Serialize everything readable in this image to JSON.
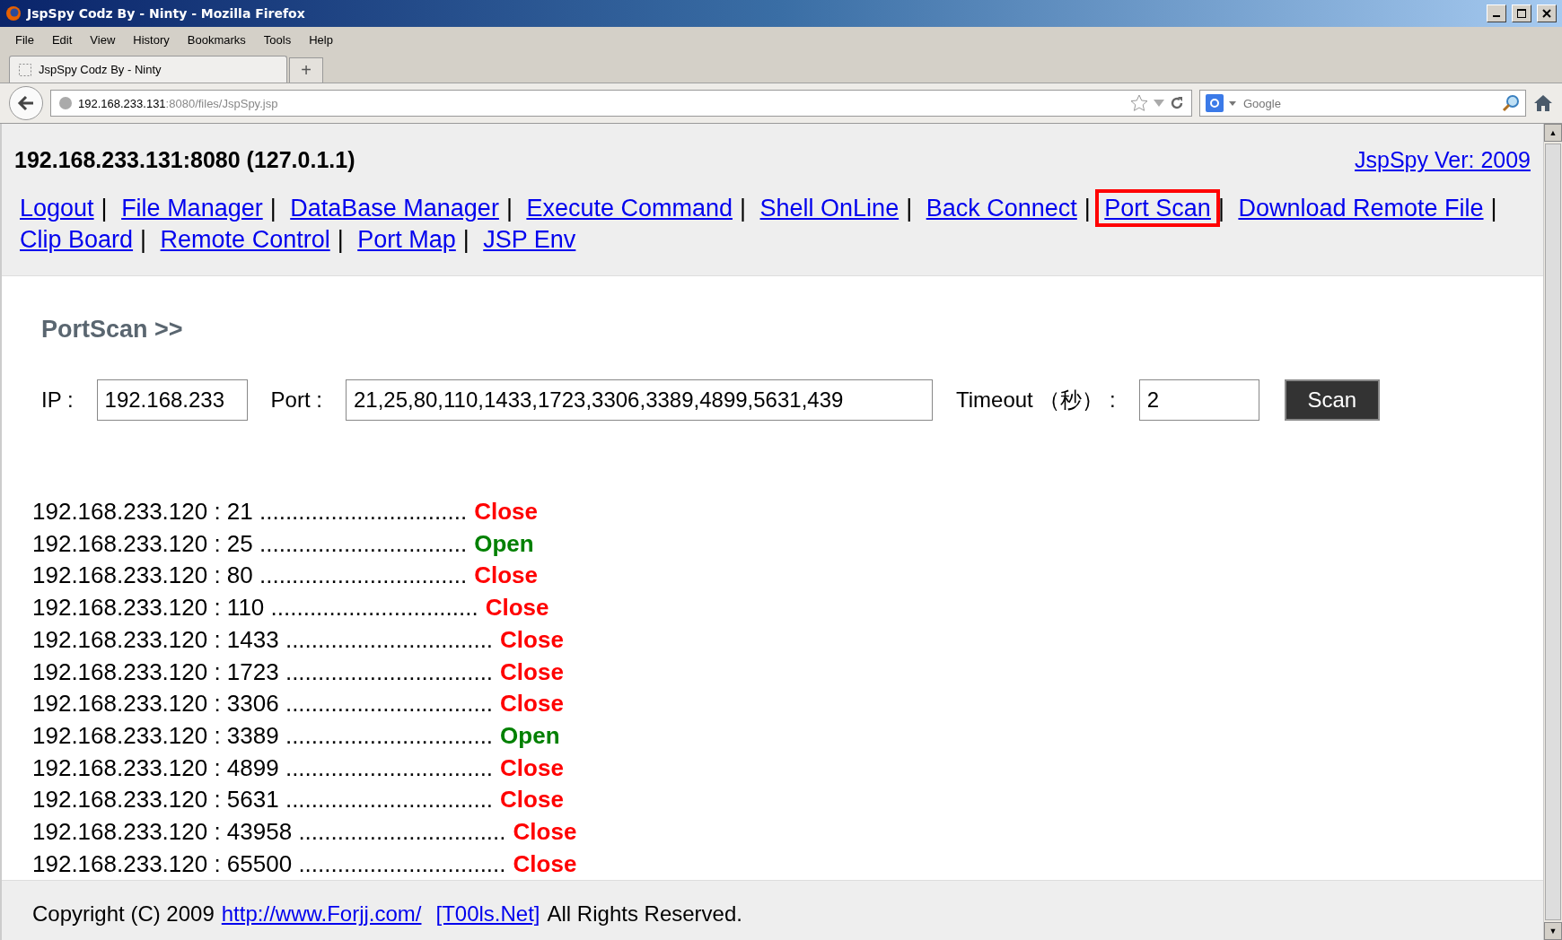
{
  "window": {
    "title": "JspSpy Codz By - Ninty - Mozilla Firefox"
  },
  "menu": [
    "File",
    "Edit",
    "View",
    "History",
    "Bookmarks",
    "Tools",
    "Help"
  ],
  "tabs": [
    {
      "label": "JspSpy Codz By - Ninty",
      "selected": true
    }
  ],
  "new_tab": "+",
  "address": {
    "host": "192.168.233.131",
    "rest": ":8080/files/JspSpy.jsp"
  },
  "search": {
    "placeholder": "Google"
  },
  "header": {
    "host": "192.168.233.131:8080 (127.0.1.1)",
    "version_link": "JspSpy Ver: 2009"
  },
  "nav_links": [
    {
      "label": "Logout",
      "highlighted": false
    },
    {
      "label": "File Manager",
      "highlighted": false
    },
    {
      "label": "DataBase Manager",
      "highlighted": false
    },
    {
      "label": "Execute Command",
      "highlighted": false
    },
    {
      "label": "Shell OnLine",
      "highlighted": false
    },
    {
      "label": "Back Connect",
      "highlighted": false
    },
    {
      "label": "Port Scan",
      "highlighted": true
    },
    {
      "label": "Download Remote File",
      "highlighted": false
    },
    {
      "label": "Clip Board",
      "highlighted": false
    },
    {
      "label": "Remote Control",
      "highlighted": false
    },
    {
      "label": "Port Map",
      "highlighted": false
    },
    {
      "label": "JSP Env",
      "highlighted": false
    }
  ],
  "nav_separator": "|",
  "scroll_up": "▲",
  "scroll_down": "▼",
  "heading": "PortScan >>",
  "form": {
    "ip_label": "IP :",
    "ip_value": "192.168.233",
    "port_label": "Port :",
    "port_value": "21,25,80,110,1433,1723,3306,3389,4899,5631,439",
    "timeout_label": "Timeout （秒） :",
    "timeout_value": "2",
    "scan_button": "Scan"
  },
  "results": [
    {
      "line": "192.168.233.120 : 21 ................................",
      "status": "Close",
      "color": "#ff0000"
    },
    {
      "line": "192.168.233.120 : 25 ................................",
      "status": "Open",
      "color": "#008000"
    },
    {
      "line": "192.168.233.120 : 80 ................................",
      "status": "Close",
      "color": "#ff0000"
    },
    {
      "line": "192.168.233.120 : 110 ................................",
      "status": "Close",
      "color": "#ff0000"
    },
    {
      "line": "192.168.233.120 : 1433 ................................",
      "status": "Close",
      "color": "#ff0000"
    },
    {
      "line": "192.168.233.120 : 1723 ................................",
      "status": "Close",
      "color": "#ff0000"
    },
    {
      "line": "192.168.233.120 : 3306 ................................",
      "status": "Close",
      "color": "#ff0000"
    },
    {
      "line": "192.168.233.120 : 3389 ................................",
      "status": "Open",
      "color": "#008000"
    },
    {
      "line": "192.168.233.120 : 4899 ................................",
      "status": "Close",
      "color": "#ff0000"
    },
    {
      "line": "192.168.233.120 : 5631 ................................",
      "status": "Close",
      "color": "#ff0000"
    },
    {
      "line": "192.168.233.120 : 43958 ................................",
      "status": "Close",
      "color": "#ff0000"
    },
    {
      "line": "192.168.233.120 : 65500 ................................",
      "status": "Close",
      "color": "#ff0000"
    }
  ],
  "footer": {
    "prefix": "Copyright (C) 2009",
    "link1": "http://www.Forjj.com/",
    "link2": "[T00ls.Net]",
    "suffix": "All Rights Reserved."
  }
}
